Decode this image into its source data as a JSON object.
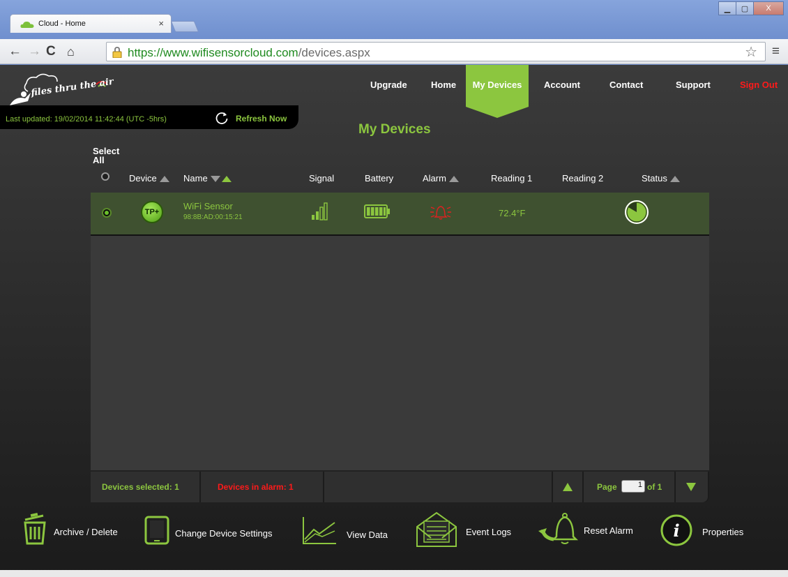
{
  "browser": {
    "tab_title": "Cloud - Home",
    "tab_close": "×",
    "url_host": "https://www.wifisensorcloud.com",
    "url_path": "/devices.aspx"
  },
  "window_controls": {
    "minimize": "▁",
    "maximize": "▢",
    "close": "X"
  },
  "logo": {
    "text": "files thru the air"
  },
  "nav": {
    "items": [
      "Upgrade",
      "Home",
      "My Devices",
      "Account",
      "Contact",
      "Support",
      "Sign Out"
    ],
    "active": "My Devices"
  },
  "update_bar": {
    "last_updated": "Last updated: 19/02/2014 11:42:44 (UTC -5hrs)",
    "refresh_label": "Refresh Now"
  },
  "page_title": "My Devices",
  "select_all": "Select All",
  "columns": {
    "device": "Device",
    "name": "Name",
    "signal": "Signal",
    "battery": "Battery",
    "alarm": "Alarm",
    "reading1": "Reading 1",
    "reading2": "Reading 2",
    "status": "Status"
  },
  "devices": [
    {
      "badge": "TP+",
      "name": "WiFi Sensor",
      "mac": "98:8B:AD:00:15:21",
      "reading1": "72.4°F",
      "reading2": "",
      "signal_bars": 4,
      "battery_level": 1.0,
      "selected": true
    }
  ],
  "footer": {
    "devices_selected": "Devices selected: 1",
    "devices_in_alarm": "Devices in alarm: 1",
    "page_label": "Page",
    "page_value": "1",
    "page_of": "of 1"
  },
  "actions": [
    "Archive / Delete",
    "Change Device Settings",
    "View Data",
    "Event Logs",
    "Reset Alarm",
    "Properties"
  ],
  "colors": {
    "accent": "#8cc63f",
    "alarm": "#ff1a1a",
    "row_bg": "#3f5130"
  }
}
